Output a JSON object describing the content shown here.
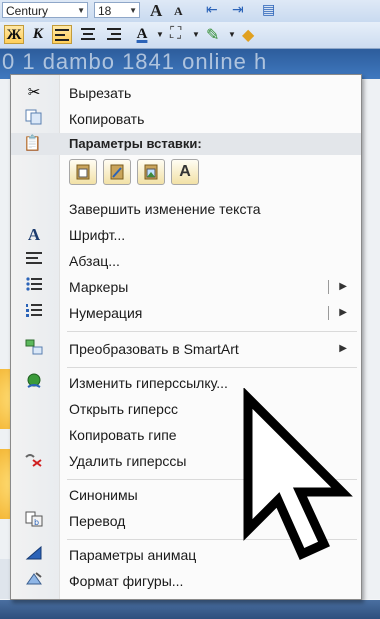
{
  "toolbar": {
    "font_name": "Century",
    "font_size": "18",
    "grow_glyph": "A",
    "shrink_glyph": "A",
    "bold_label": "Ж",
    "italic_label": "К"
  },
  "slide": {
    "title_fragment": "0 1 dambo 1841 online h"
  },
  "menu": {
    "items": [
      {
        "label": "Вырезать",
        "icon": "scissors-icon"
      },
      {
        "label": "Копировать",
        "icon": "copy-icon"
      },
      {
        "label": "Параметры вставки:",
        "icon": "clipboard-icon"
      },
      {
        "label": "Завершить изменение текста",
        "icon": ""
      },
      {
        "label": "Шрифт...",
        "icon": "font-icon"
      },
      {
        "label": "Абзац...",
        "icon": "paragraph-icon"
      },
      {
        "label": "Маркеры",
        "icon": "bullets-icon"
      },
      {
        "label": "Нумерация",
        "icon": "numbering-icon"
      },
      {
        "label": "Преобразовать в SmartArt",
        "icon": "smartart-icon"
      },
      {
        "label": "Изменить гиперссылку...",
        "icon": "hyperlink-icon"
      },
      {
        "label": "Открыть гиперсс",
        "icon": ""
      },
      {
        "label": "Копировать гипе",
        "icon": ""
      },
      {
        "label": "Удалить гиперссы",
        "icon": "remove-link-icon"
      },
      {
        "label": "Синонимы",
        "icon": ""
      },
      {
        "label": "Перевод",
        "icon": "translate-icon"
      },
      {
        "label": "Параметры анимац",
        "icon": "animation-icon"
      },
      {
        "label": "Формат фигуры...",
        "icon": "format-shape-icon"
      }
    ],
    "paste_options": [
      {
        "icon": "paste-keep-formatting-icon"
      },
      {
        "icon": "paste-merge-icon"
      },
      {
        "icon": "paste-picture-icon"
      },
      {
        "icon": "paste-text-only-icon",
        "glyph": "A"
      }
    ]
  },
  "colors": {
    "menu_bg": "#fbfbfb",
    "gutter": "#eeeeee",
    "accent_blue": "#2b63b8",
    "highlight": "#ffcf5a"
  }
}
